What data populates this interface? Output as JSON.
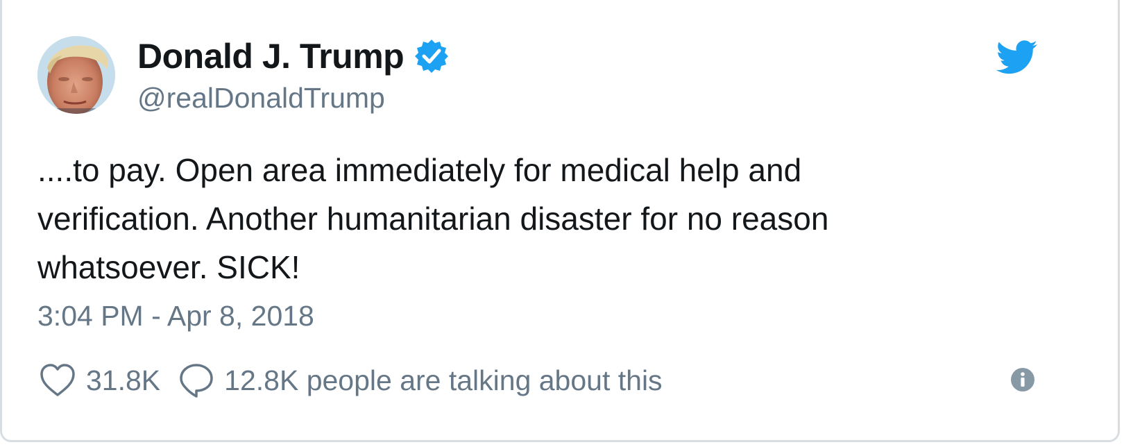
{
  "author": {
    "display_name": "Donald J. Trump",
    "handle": "@realDonaldTrump",
    "verified": true
  },
  "tweet": {
    "text_lines": [
      "....to pay. Open area immediately for medical help and",
      "verification. Another humanitarian disaster for no reason",
      "whatsoever. SICK!"
    ],
    "timestamp": "3:04 PM - Apr 8, 2018"
  },
  "engagement": {
    "likes": "31.8K",
    "talking": "12.8K people are talking about this"
  },
  "icons": {
    "verified": "verified-badge-icon",
    "brand": "twitter-bird-icon",
    "like": "heart-icon",
    "reply": "reply-bubble-icon",
    "info": "info-icon"
  },
  "colors": {
    "brand_blue": "#1da1f2",
    "text_primary": "#14171a",
    "text_secondary": "#657786",
    "border": "#d8dde2"
  }
}
